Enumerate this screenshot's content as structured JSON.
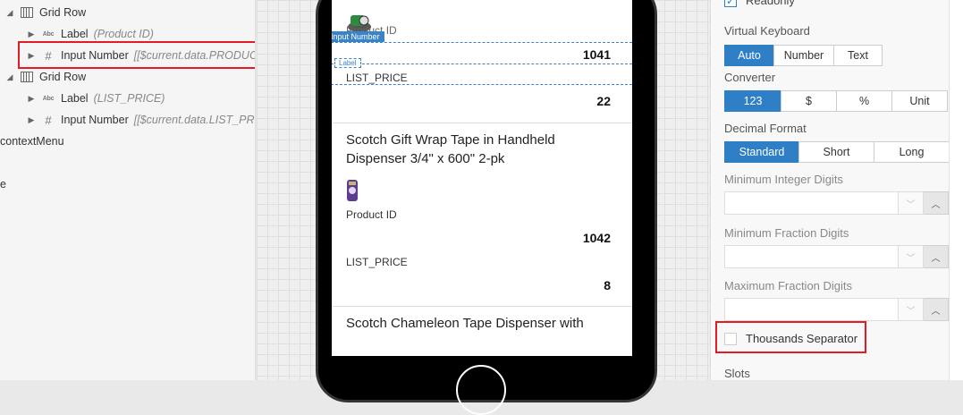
{
  "tree": {
    "rows": [
      {
        "label": "Grid Row",
        "binding": ""
      },
      {
        "label": "Label",
        "binding": "(Product ID)"
      },
      {
        "label": "Input Number",
        "binding": "[[$current.data.PRODUCT"
      },
      {
        "label": "Grid Row",
        "binding": ""
      },
      {
        "label": "Label",
        "binding": "(LIST_PRICE)"
      },
      {
        "label": "Input Number",
        "binding": "[[$current.data.LIST_PRIC"
      },
      {
        "label": "contextMenu",
        "binding": ""
      },
      {
        "label": "e",
        "binding": ""
      }
    ],
    "abc_text": "Abc",
    "hash_text": "#"
  },
  "canvas": {
    "item1": {
      "label_product_id": "Product ID",
      "selected_component_tag": "Input Number",
      "selected_label_tag": "Label",
      "product_id_value": "1041",
      "list_price_label": "LIST_PRICE",
      "list_price_value": "22"
    },
    "item2": {
      "name": "Scotch Gift Wrap Tape in Handheld Dispenser 3/4\" x 600\" 2-pk",
      "label_product_id": "Product ID",
      "product_id_value": "1042",
      "list_price_label": "LIST_PRICE",
      "list_price_value": "8"
    },
    "item3": {
      "name": "Scotch Chameleon Tape Dispenser with"
    }
  },
  "props": {
    "readonly_label": "Readonly",
    "readonly_checked": true,
    "virtual_keyboard": {
      "heading": "Virtual Keyboard",
      "options": [
        "Auto",
        "Number",
        "Text"
      ],
      "selected": "Auto"
    },
    "converter": {
      "heading": "Converter",
      "options": [
        "123",
        "$",
        "%",
        "Unit"
      ],
      "selected": "123"
    },
    "decimal_format": {
      "heading": "Decimal Format",
      "options": [
        "Standard",
        "Short",
        "Long"
      ],
      "selected": "Standard"
    },
    "min_integer_digits": {
      "heading": "Minimum Integer Digits",
      "value": ""
    },
    "min_fraction_digits": {
      "heading": "Minimum Fraction Digits",
      "value": ""
    },
    "max_fraction_digits": {
      "heading": "Maximum Fraction Digits",
      "value": ""
    },
    "thousands_separator": {
      "label": "Thousands Separator",
      "checked": false
    },
    "slots_heading": "Slots"
  },
  "colors": {
    "accent": "#2f7fc7",
    "highlight": "#e31c23",
    "selection": "#3a83c9"
  },
  "icons": {
    "collapse_arrow": "triangle-down",
    "expand_arrow": "triangle-right",
    "grid_row": "grid-row-icon",
    "label": "abc-label-icon",
    "input_number": "hash-icon",
    "dropdown": "chevron-down-icon",
    "stepper": "chevron-up-icon",
    "check": "check-icon"
  }
}
